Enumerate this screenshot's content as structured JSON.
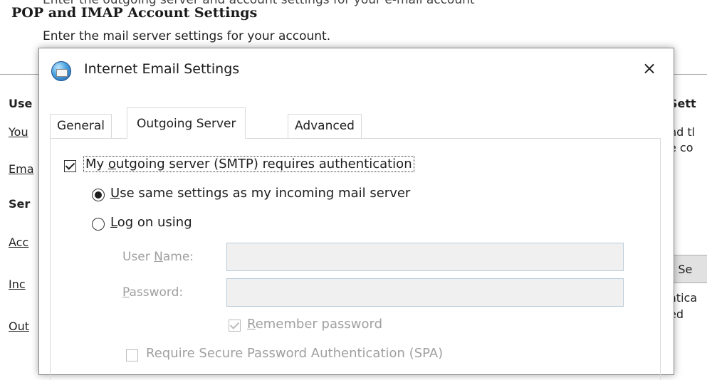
{
  "wizard": {
    "title": "POP and IMAP Account Settings",
    "subtitle": "Enter the mail server settings for your account."
  },
  "background_left": {
    "user_info": "Use",
    "your_name": "You",
    "email": "Ema",
    "server_info": "Ser",
    "account_type": "Acc",
    "incoming": "Inc",
    "outgoing": "Out"
  },
  "background_right": {
    "settings_head": "Sett",
    "line1": "nd tl",
    "line2": "e co",
    "button_partial": "t Se",
    "line3": "atica",
    "line4": "ed"
  },
  "dialog": {
    "title": "Internet Email Settings",
    "close_glyph": "×",
    "icon": "outlook-globe-envelope-icon",
    "tabs": [
      {
        "label": "General",
        "active": false
      },
      {
        "label": "Outgoing Server",
        "active": true
      },
      {
        "label": "Advanced",
        "active": false
      }
    ],
    "smtp_auth": {
      "checked": true,
      "label_pre": "My ",
      "label_mnemonic": "o",
      "label_post": "utgoing server (SMTP) requires authentication"
    },
    "radio_same": {
      "selected": true,
      "label_mnemonic": "U",
      "label_post": "se same settings as my incoming mail server"
    },
    "radio_logon": {
      "selected": false,
      "label_mnemonic": "L",
      "label_post": "og on using"
    },
    "username": {
      "label_pre": "User ",
      "label_mnemonic": "N",
      "label_post": "ame:",
      "value": ""
    },
    "password": {
      "label_mnemonic": "P",
      "label_post": "assword:",
      "value": ""
    },
    "remember": {
      "checked": true,
      "label_mnemonic": "R",
      "label_post": "emember password"
    },
    "spa": {
      "checked": false,
      "label": "Require Secure Password Authentication (SPA)"
    }
  },
  "colors": {
    "dialog_border": "#8a8a8a",
    "disabled_text": "#a0a0a0",
    "field_border": "#b9cbd9"
  }
}
